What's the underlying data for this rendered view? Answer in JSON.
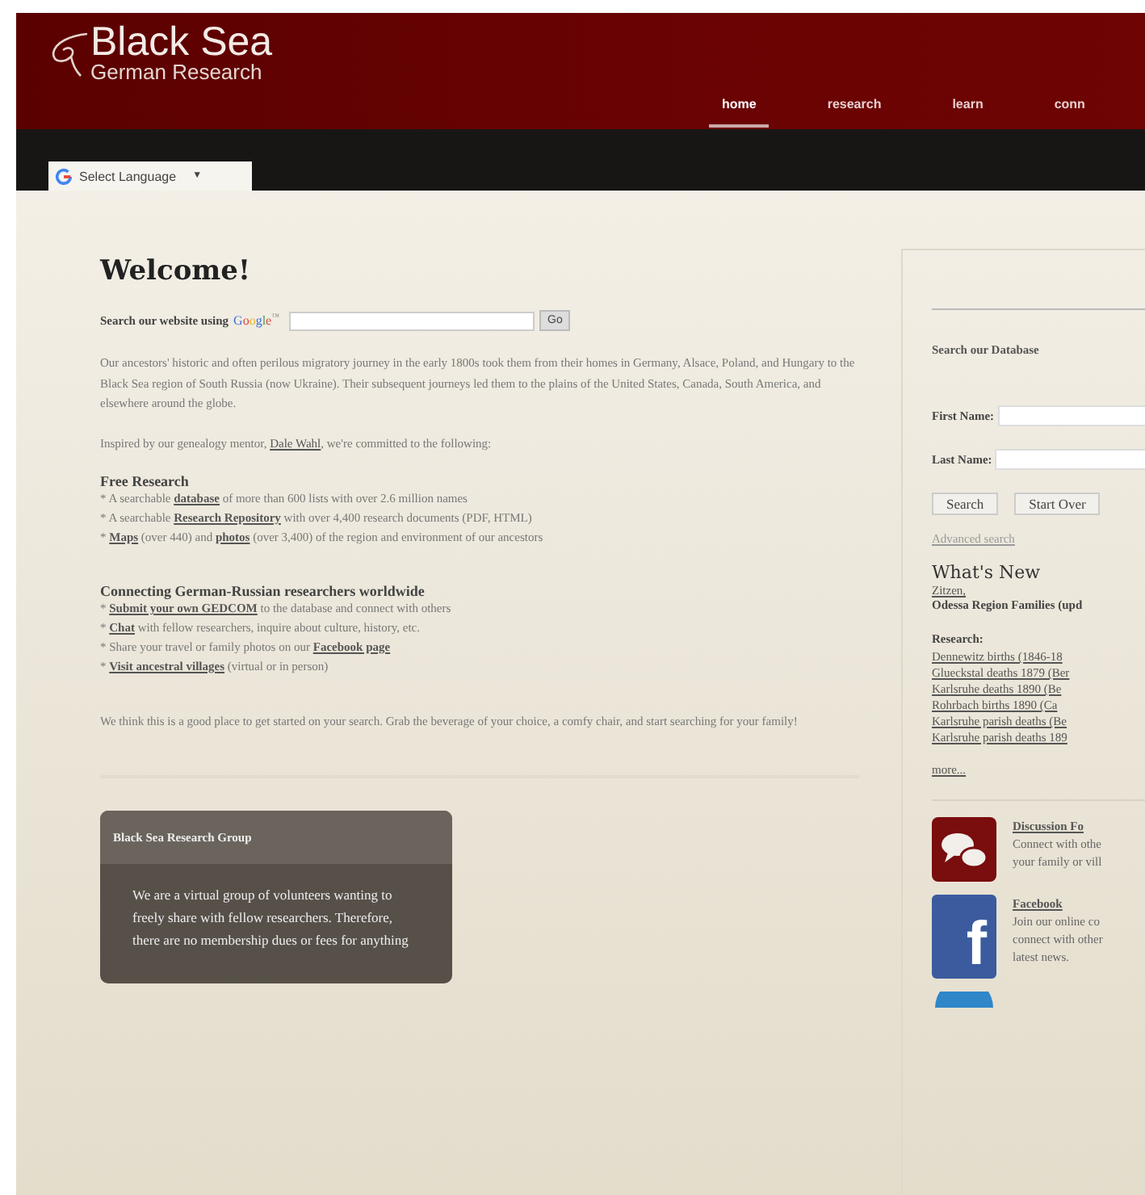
{
  "header": {
    "title": "Black Sea",
    "subtitle": "German Research"
  },
  "nav": [
    {
      "label": "home",
      "selected": true
    },
    {
      "label": "research",
      "selected": false
    },
    {
      "label": "learn",
      "selected": false
    },
    {
      "label": "conn",
      "selected": false
    }
  ],
  "language": {
    "label": "Select Language",
    "caret": "▼"
  },
  "main": {
    "heading": "Welcome!",
    "search_label": "Search our website using",
    "google": "Google",
    "tm": "™",
    "go": "Go",
    "intro": "Our ancestors' historic and often perilous migratory journey in the early 1800s took them from their homes in Germany, Alsace, Poland, and Hungary to the Black Sea region of South Russia (now Ukraine). Their subsequent journeys led them to the plains of the United States, Canada, South America, and elsewhere around the globe.",
    "inspired": [
      {
        "text": "Inspired by our genealogy mentor, "
      },
      {
        "text": "Dale Wahl",
        "link": true
      },
      {
        "text": ", we're committed to the following:"
      }
    ],
    "sections": [
      {
        "title": "Free Research",
        "items": [
          [
            {
              "text": "* A searchable "
            },
            {
              "text": "database",
              "link": true
            },
            {
              "text": " of more than 600 lists with over 2.6 million names"
            }
          ],
          [
            {
              "text": "* A searchable "
            },
            {
              "text": "Research Repository",
              "link": true
            },
            {
              "text": " with over 4,400 research documents (PDF, HTML)"
            }
          ],
          [
            {
              "text": "* "
            },
            {
              "text": "Maps",
              "link": true
            },
            {
              "text": " (over 440) and "
            },
            {
              "text": "photos",
              "link": true
            },
            {
              "text": " (over 3,400) of the region and environment of our ancestors"
            }
          ]
        ]
      },
      {
        "title": "Connecting German-Russian researchers worldwide",
        "items": [
          [
            {
              "text": "* "
            },
            {
              "text": "Submit your own GEDCOM",
              "link": true
            },
            {
              "text": " to the database and connect with others"
            }
          ],
          [
            {
              "text": "* "
            },
            {
              "text": "Chat",
              "link": true
            },
            {
              "text": " with fellow researchers, inquire about culture, history, etc."
            }
          ],
          [
            {
              "text": "* Share your travel or family photos on our "
            },
            {
              "text": "Facebook page",
              "link": true
            }
          ],
          [
            {
              "text": "* "
            },
            {
              "text": "Visit ancestral villages",
              "link": true
            },
            {
              "text": " (virtual or in person)"
            }
          ]
        ]
      }
    ],
    "closing": "We think this is a good place to get started on your search. Grab the beverage of your choice, a comfy chair, and start searching for your family!",
    "group": {
      "title": "Black Sea Research Group",
      "text": "We are a virtual group of volunteers wanting to freely share with fellow researchers. Therefore, there are no membership dues or fees for anything"
    }
  },
  "sidebar": {
    "search_title": "Search our Database",
    "first_name": "First Name:",
    "last_name": "Last Name:",
    "buttons": [
      "Search",
      "Start Over"
    ],
    "advanced": "Advanced search",
    "whats_new": "What's New",
    "new_link": "Zitzen,",
    "new_text": "Odessa Region Families (upd",
    "research_title": "Research:",
    "research_links": [
      "Dennewitz births (1846-18",
      "Glueckstal deaths 1879 (Ber",
      "Karlsruhe deaths 1890 (Be",
      "Rohrbach births 1890 (Ca",
      "Karlsruhe parish deaths (Be",
      "Karlsruhe parish deaths 189"
    ],
    "more": "more...",
    "features": [
      {
        "kind": "discussion",
        "title": "Discussion Fo",
        "lines": [
          "Connect with othe",
          "your family or vill"
        ]
      },
      {
        "kind": "facebook",
        "glyph": "f",
        "title": "Facebook",
        "lines": [
          "Join our online co",
          "connect with other",
          "latest news."
        ]
      },
      {
        "kind": "globe"
      }
    ]
  }
}
